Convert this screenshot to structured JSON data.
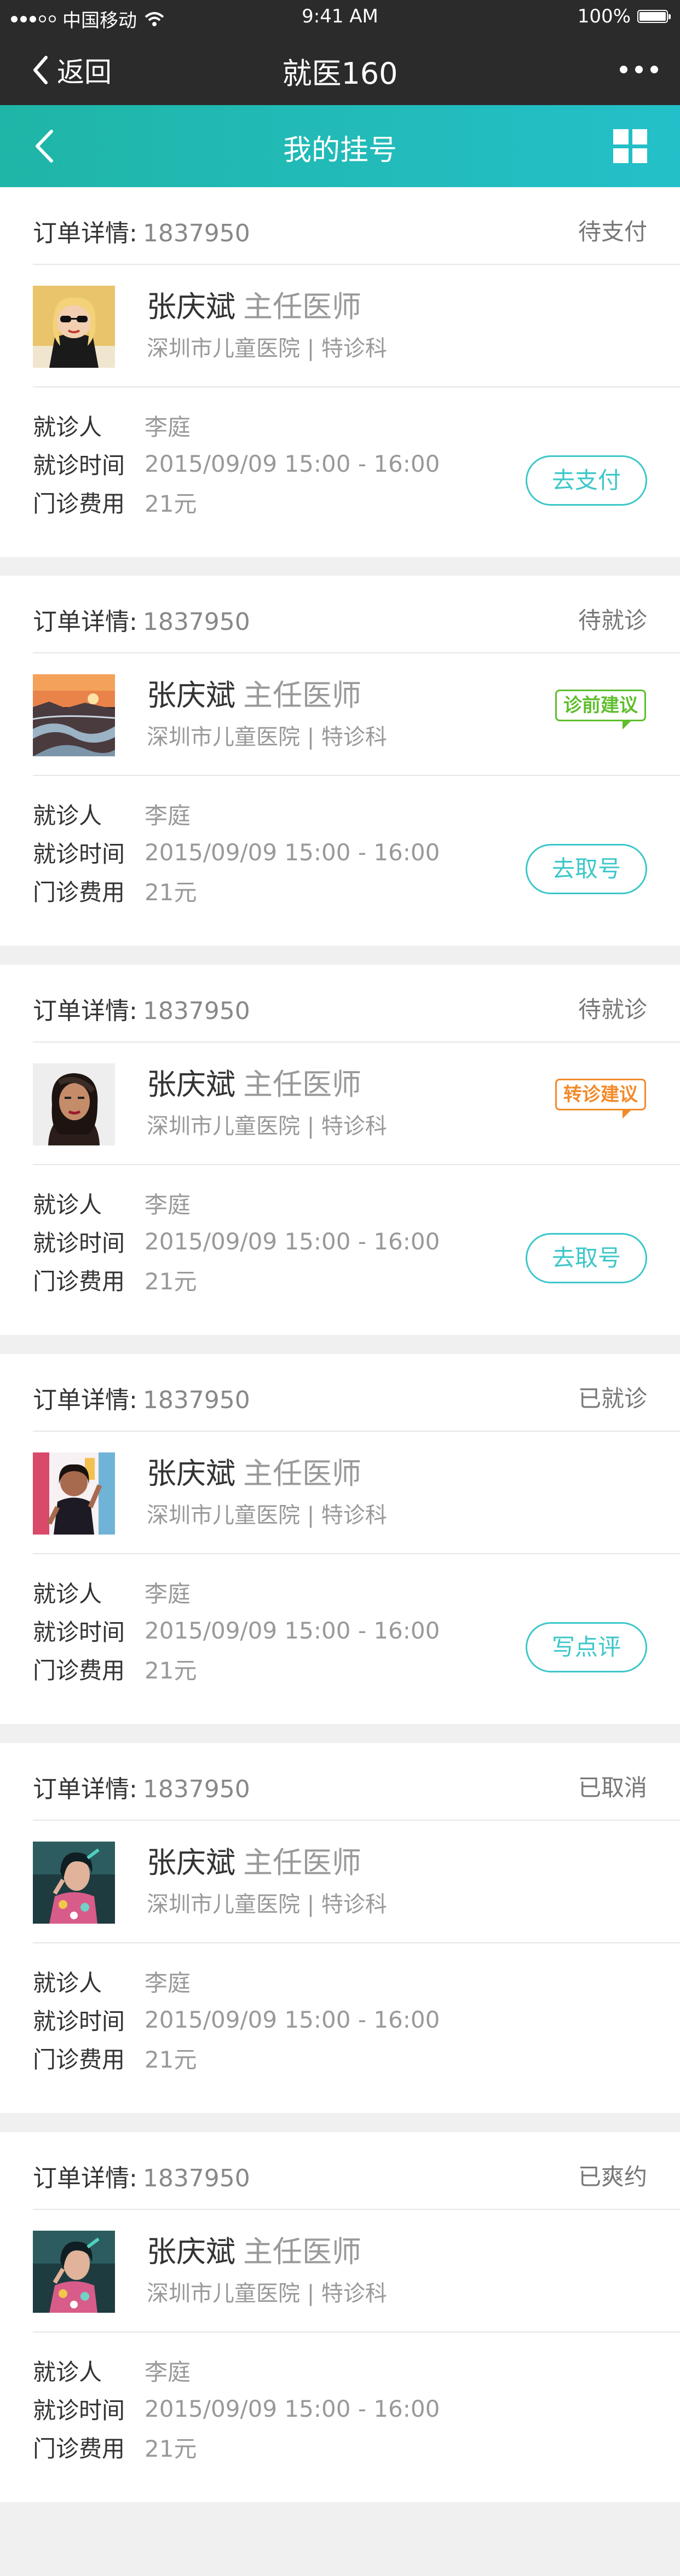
{
  "status_bar": {
    "carrier": "中国移动",
    "time": "9:41 AM",
    "battery": "100%"
  },
  "wx_nav": {
    "back_label": "返回",
    "title": "就医160"
  },
  "header": {
    "title": "我的挂号"
  },
  "labels": {
    "order": "订单详情:",
    "patient": "就诊人",
    "time": "就诊时间",
    "fee": "门诊费用"
  },
  "orders": [
    {
      "order_no": "1837950",
      "status": "待支付",
      "doctor": "张庆斌",
      "title": "主任医师",
      "hospital": "深圳市儿童医院 | 特诊科",
      "patient": "李庭",
      "time": "2015/09/09 15:00 - 16:00",
      "fee": "21元",
      "tag": "",
      "button": "去支付"
    },
    {
      "order_no": "1837950",
      "status": "待就诊",
      "doctor": "张庆斌",
      "title": "主任医师",
      "hospital": "深圳市儿童医院 | 特诊科",
      "patient": "李庭",
      "time": "2015/09/09 15:00 - 16:00",
      "fee": "21元",
      "tag": "诊前建议",
      "button": "去取号"
    },
    {
      "order_no": "1837950",
      "status": "待就诊",
      "doctor": "张庆斌",
      "title": "主任医师",
      "hospital": "深圳市儿童医院 | 特诊科",
      "patient": "李庭",
      "time": "2015/09/09 15:00 - 16:00",
      "fee": "21元",
      "tag": "转诊建议",
      "button": "去取号"
    },
    {
      "order_no": "1837950",
      "status": "已就诊",
      "doctor": "张庆斌",
      "title": "主任医师",
      "hospital": "深圳市儿童医院 | 特诊科",
      "patient": "李庭",
      "time": "2015/09/09 15:00 - 16:00",
      "fee": "21元",
      "tag": "",
      "button": "写点评"
    },
    {
      "order_no": "1837950",
      "status": "已取消",
      "doctor": "张庆斌",
      "title": "主任医师",
      "hospital": "深圳市儿童医院 | 特诊科",
      "patient": "李庭",
      "time": "2015/09/09 15:00 - 16:00",
      "fee": "21元",
      "tag": "",
      "button": ""
    },
    {
      "order_no": "1837950",
      "status": "已爽约",
      "doctor": "张庆斌",
      "title": "主任医师",
      "hospital": "深圳市儿童医院 | 特诊科",
      "patient": "李庭",
      "time": "2015/09/09 15:00 - 16:00",
      "fee": "21元",
      "tag": "",
      "button": ""
    }
  ],
  "colors": {
    "accent": "#3cc7c9",
    "header_start": "#1fb5a7",
    "header_end": "#24c0c9",
    "tag_green": "#5fbe2e",
    "tag_orange": "#f28a2a"
  }
}
